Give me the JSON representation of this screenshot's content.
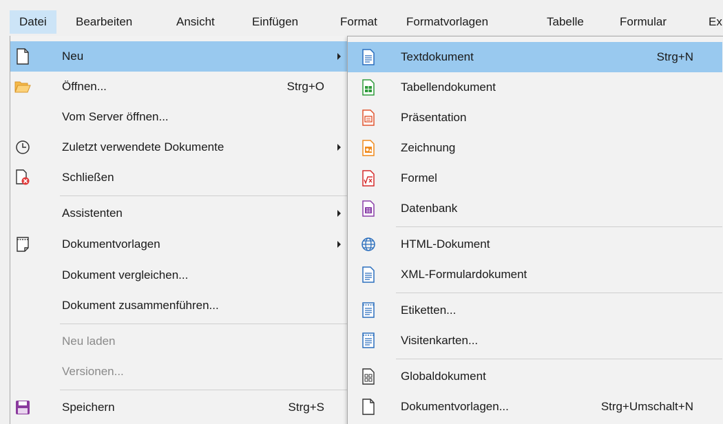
{
  "menubar": {
    "items": [
      "Datei",
      "Bearbeiten",
      "Ansicht",
      "Einfügen",
      "Format",
      "Formatvorlagen",
      "Tabelle",
      "Formular",
      "Ex"
    ]
  },
  "file_menu": {
    "items": [
      {
        "label": "Neu",
        "shortcut": "",
        "icon": "new-document-icon",
        "submenu": true,
        "highlighted": true,
        "enabled": true
      },
      {
        "label": "Öffnen...",
        "shortcut": "Strg+O",
        "icon": "folder-open-icon",
        "submenu": false,
        "enabled": true
      },
      {
        "label": "Vom Server öffnen...",
        "shortcut": "",
        "icon": "",
        "submenu": false,
        "enabled": true
      },
      {
        "label": "Zuletzt verwendete Dokumente",
        "shortcut": "",
        "icon": "clock-icon",
        "submenu": true,
        "enabled": true
      },
      {
        "label": "Schließen",
        "shortcut": "",
        "icon": "close-document-icon",
        "submenu": false,
        "enabled": true
      },
      {
        "label": "Assistenten",
        "shortcut": "",
        "icon": "",
        "submenu": true,
        "enabled": true
      },
      {
        "label": "Dokumentvorlagen",
        "shortcut": "",
        "icon": "templates-icon",
        "submenu": true,
        "enabled": true
      },
      {
        "label": "Dokument vergleichen...",
        "shortcut": "",
        "icon": "",
        "submenu": false,
        "enabled": true
      },
      {
        "label": "Dokument zusammenführen...",
        "shortcut": "",
        "icon": "",
        "submenu": false,
        "enabled": true
      },
      {
        "label": "Neu laden",
        "shortcut": "",
        "icon": "",
        "submenu": false,
        "enabled": false
      },
      {
        "label": "Versionen...",
        "shortcut": "",
        "icon": "",
        "submenu": false,
        "enabled": false
      },
      {
        "label": "Speichern",
        "shortcut": "Strg+S",
        "icon": "save-icon",
        "submenu": false,
        "enabled": true
      }
    ]
  },
  "new_submenu": {
    "items": [
      {
        "label": "Textdokument",
        "shortcut": "Strg+N",
        "icon": "text-document-icon",
        "highlighted": true
      },
      {
        "label": "Tabellendokument",
        "shortcut": "",
        "icon": "spreadsheet-icon"
      },
      {
        "label": "Präsentation",
        "shortcut": "",
        "icon": "presentation-icon"
      },
      {
        "label": "Zeichnung",
        "shortcut": "",
        "icon": "drawing-icon"
      },
      {
        "label": "Formel",
        "shortcut": "",
        "icon": "formula-icon"
      },
      {
        "label": "Datenbank",
        "shortcut": "",
        "icon": "database-icon"
      },
      {
        "label": "HTML-Dokument",
        "shortcut": "",
        "icon": "globe-icon"
      },
      {
        "label": "XML-Formulardokument",
        "shortcut": "",
        "icon": "xml-form-icon"
      },
      {
        "label": "Etiketten...",
        "shortcut": "",
        "icon": "labels-icon"
      },
      {
        "label": "Visitenkarten...",
        "shortcut": "",
        "icon": "business-cards-icon"
      },
      {
        "label": "Globaldokument",
        "shortcut": "",
        "icon": "master-document-icon"
      },
      {
        "label": "Dokumentvorlagen...",
        "shortcut": "Strg+Umschalt+N",
        "icon": "template-document-icon"
      }
    ]
  },
  "colors": {
    "menu_bg": "#f2f2f2",
    "highlight": "#99c9ef",
    "menubar_active": "#cce4f7",
    "writer_blue": "#2a6ebd",
    "calc_green": "#2e9b3a",
    "impress_orange": "#e0542f",
    "draw_orange": "#f08a1c",
    "math_red": "#d52b2b",
    "base_purple": "#8a3fa8",
    "save_purple": "#8b3a9e"
  }
}
